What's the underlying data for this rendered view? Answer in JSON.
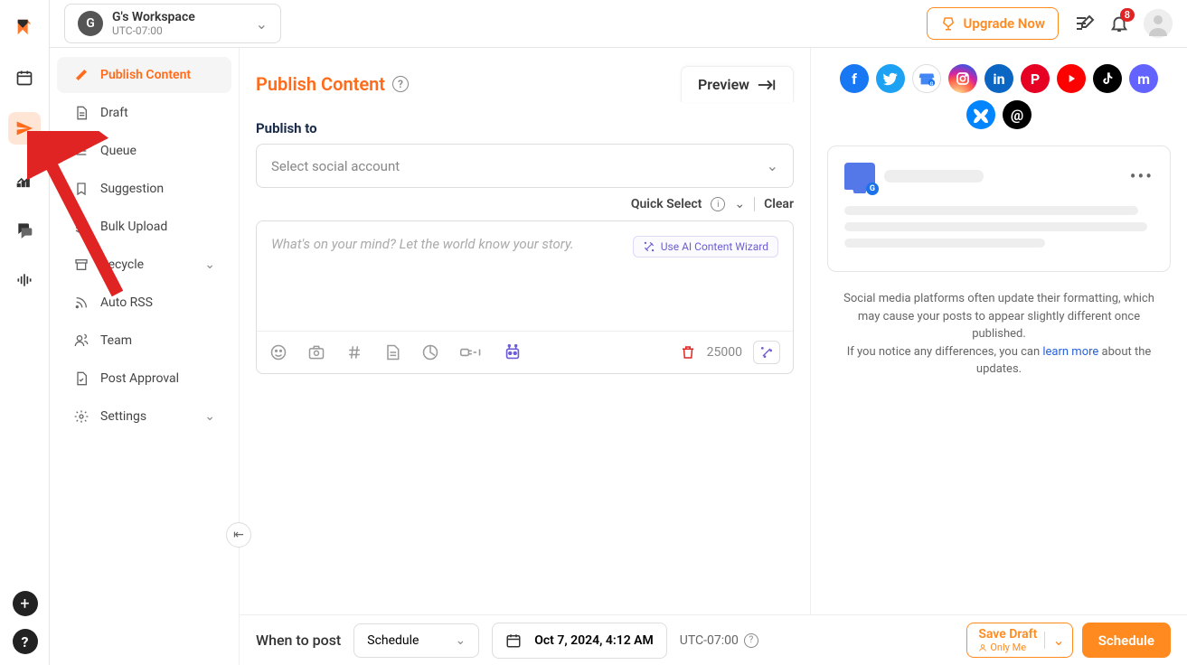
{
  "workspace": {
    "avatar_letter": "G",
    "name": "G's Workspace",
    "timezone": "UTC-07:00"
  },
  "header": {
    "upgrade": "Upgrade Now",
    "notification_count": "8"
  },
  "sidebar": {
    "items": [
      {
        "label": "Publish Content"
      },
      {
        "label": "Draft"
      },
      {
        "label": "Queue"
      },
      {
        "label": "Suggestion"
      },
      {
        "label": "Bulk Upload"
      },
      {
        "label": "Recycle"
      },
      {
        "label": "Auto RSS"
      },
      {
        "label": "Team"
      },
      {
        "label": "Post Approval"
      },
      {
        "label": "Settings"
      }
    ]
  },
  "main": {
    "title": "Publish Content",
    "preview": "Preview",
    "publish_to": "Publish to",
    "select_account": "Select social account",
    "quick_select": "Quick Select",
    "clear": "Clear",
    "placeholder": "What's on your mind? Let the world know your story.",
    "ai_wizard": "Use AI Content Wizard",
    "char_count": "25000"
  },
  "schedule": {
    "when": "When to post",
    "mode": "Schedule",
    "date": "Oct 7, 2024, 4:12 AM",
    "tz": "UTC-07:00",
    "save_draft": "Save Draft",
    "only_me": "Only Me",
    "schedule_btn": "Schedule"
  },
  "socials": [
    "facebook",
    "twitter",
    "google-business",
    "instagram",
    "linkedin",
    "pinterest",
    "youtube",
    "tiktok",
    "mastodon",
    "bluesky",
    "threads"
  ],
  "social_colors": {
    "facebook": "#1877f2",
    "twitter": "#1da1f2",
    "google-business": "#4285f4",
    "instagram": "#e1306c",
    "linkedin": "#0a66c2",
    "pinterest": "#e60023",
    "youtube": "#ff0000",
    "tiktok": "#000000",
    "mastodon": "#6364ff",
    "bluesky": "#0085ff",
    "threads": "#000000"
  },
  "notice": {
    "line1": "Social media platforms often update their formatting, which may cause your posts to appear slightly different once published.",
    "line2a": "If you notice any differences, you can ",
    "learn_more": "learn more",
    "line2b": " about the updates."
  }
}
